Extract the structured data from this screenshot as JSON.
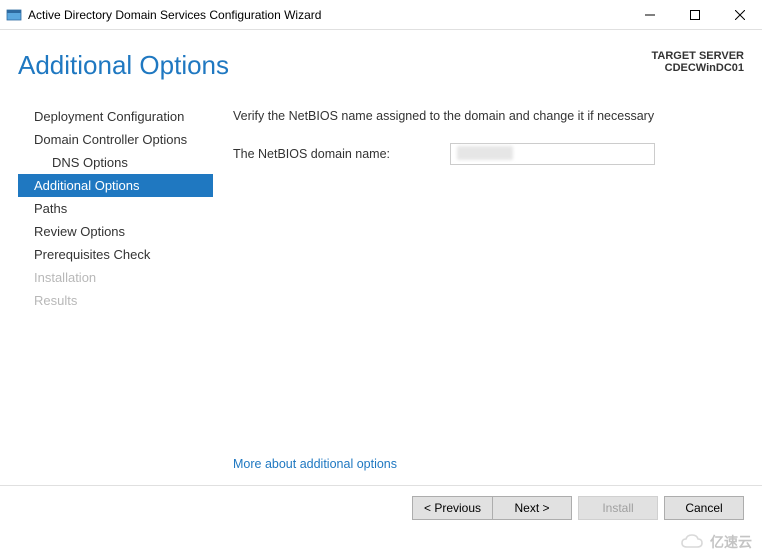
{
  "window": {
    "title": "Active Directory Domain Services Configuration Wizard"
  },
  "header": {
    "page_title": "Additional Options",
    "target_server_label": "TARGET SERVER",
    "target_server_value": "CDECWinDC01"
  },
  "sidebar": {
    "items": [
      {
        "label": "Deployment Configuration",
        "state": "normal"
      },
      {
        "label": "Domain Controller Options",
        "state": "normal"
      },
      {
        "label": "DNS Options",
        "state": "normal",
        "indent": true
      },
      {
        "label": "Additional Options",
        "state": "selected"
      },
      {
        "label": "Paths",
        "state": "normal"
      },
      {
        "label": "Review Options",
        "state": "normal"
      },
      {
        "label": "Prerequisites Check",
        "state": "normal"
      },
      {
        "label": "Installation",
        "state": "disabled"
      },
      {
        "label": "Results",
        "state": "disabled"
      }
    ]
  },
  "main": {
    "instruction": "Verify the NetBIOS name assigned to the domain and change it if necessary",
    "netbios_label": "The NetBIOS domain name:",
    "netbios_value": "",
    "more_link": "More about additional options"
  },
  "footer": {
    "previous": "< Previous",
    "next": "Next >",
    "install": "Install",
    "cancel": "Cancel"
  },
  "watermark": {
    "text": "亿速云"
  }
}
